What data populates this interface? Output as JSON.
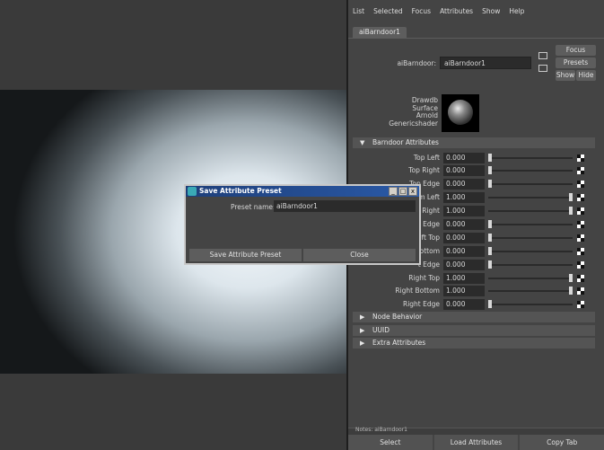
{
  "menu": [
    "List",
    "Selected",
    "Focus",
    "Attributes",
    "Show",
    "Help"
  ],
  "tab": "aiBarndoor1",
  "node": {
    "label": "aiBarndoor:",
    "value": "aiBarndoor1"
  },
  "side_buttons": {
    "focus": "Focus",
    "presets": "Presets",
    "show": "Show",
    "hide": "Hide"
  },
  "swatch_text": [
    "Drawdb",
    "Surface",
    "Arnold",
    "Genericshader"
  ],
  "sections": {
    "barndoor": "Barndoor Attributes",
    "node_behavior": "Node Behavior",
    "uuid": "UUID",
    "extra": "Extra Attributes"
  },
  "attributes": [
    {
      "label": "Top Left",
      "value": "0.000",
      "level": 0.0
    },
    {
      "label": "Top Right",
      "value": "0.000",
      "level": 0.0
    },
    {
      "label": "Top Edge",
      "value": "0.000",
      "level": 0.0
    },
    {
      "label": "m Left",
      "value": "1.000",
      "level": 1.0
    },
    {
      "label": "n Right",
      "value": "1.000",
      "level": 1.0
    },
    {
      "label": "n Edge",
      "value": "0.000",
      "level": 0.0
    },
    {
      "label": "eft Top",
      "value": "0.000",
      "level": 0.0
    },
    {
      "label": "Bottom",
      "value": "0.000",
      "level": 0.0
    },
    {
      "label": "t Edge",
      "value": "0.000",
      "level": 0.0
    },
    {
      "label": "Right Top",
      "value": "1.000",
      "level": 1.0
    },
    {
      "label": "Right Bottom",
      "value": "1.000",
      "level": 1.0
    },
    {
      "label": "Right Edge",
      "value": "0.000",
      "level": 0.0
    }
  ],
  "notes_label": "Notes: aiBarndoor1",
  "bottom_buttons": [
    "Select",
    "Load Attributes",
    "Copy Tab"
  ],
  "dialog": {
    "title": "Save Attribute Preset",
    "preset_label": "Preset name:",
    "preset_value": "aiBarndoor1",
    "save_button": "Save Attribute Preset",
    "close_button": "Close",
    "win_buttons": [
      "_",
      "□",
      "x"
    ]
  }
}
